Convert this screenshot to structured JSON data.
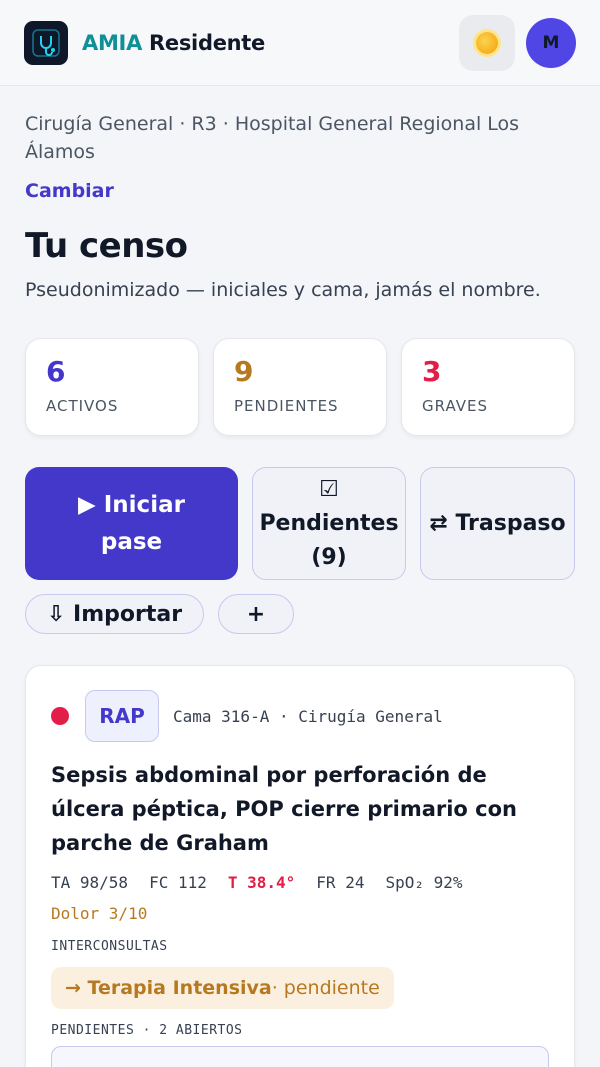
{
  "header": {
    "brand_accent": "AMIA",
    "brand_rest": "Residente",
    "avatar_initial": "M"
  },
  "context": {
    "service_line": "Cirugía General · R3 · Hospital General Regional Los Álamos",
    "change_label": "Cambiar"
  },
  "page": {
    "title": "Tu censo",
    "subtitle": "Pseudonimizado — iniciales y cama, jamás el nombre."
  },
  "stats": [
    {
      "value": "6",
      "label": "ACTIVOS",
      "color": "#4338ca"
    },
    {
      "value": "9",
      "label": "PENDIENTES",
      "color": "#b7791f"
    },
    {
      "value": "3",
      "label": "GRAVES",
      "color": "#e11d48"
    }
  ],
  "actions": {
    "start_round": "▶ Iniciar pase",
    "pending_icon": "☑",
    "pending_label": "Pendientes",
    "pending_count": "(9)",
    "handoff": "⇄ Traspaso",
    "import": "⇩ Importar",
    "add": "+"
  },
  "patient": {
    "initials": "RAP",
    "location": "Cama 316-A · Cirugía General",
    "severity_color": "#e11d48",
    "diagnosis": "Sepsis abdominal por perforación de úlcera péptica, POP cierre primario con parche de Graham",
    "vitals": {
      "ta": "TA 98/58",
      "fc": "FC 112",
      "t": "T 38.4°",
      "fr": "FR 24",
      "spo2": "SpO₂ 92%",
      "pain": "Dolor 3/10"
    },
    "consults_header": "INTERCONSULTAS",
    "consult_service": "→ Terapia Intensiva",
    "consult_status": " · pendiente",
    "pending_header": "PENDIENTES · 2 ABIERTOS"
  }
}
